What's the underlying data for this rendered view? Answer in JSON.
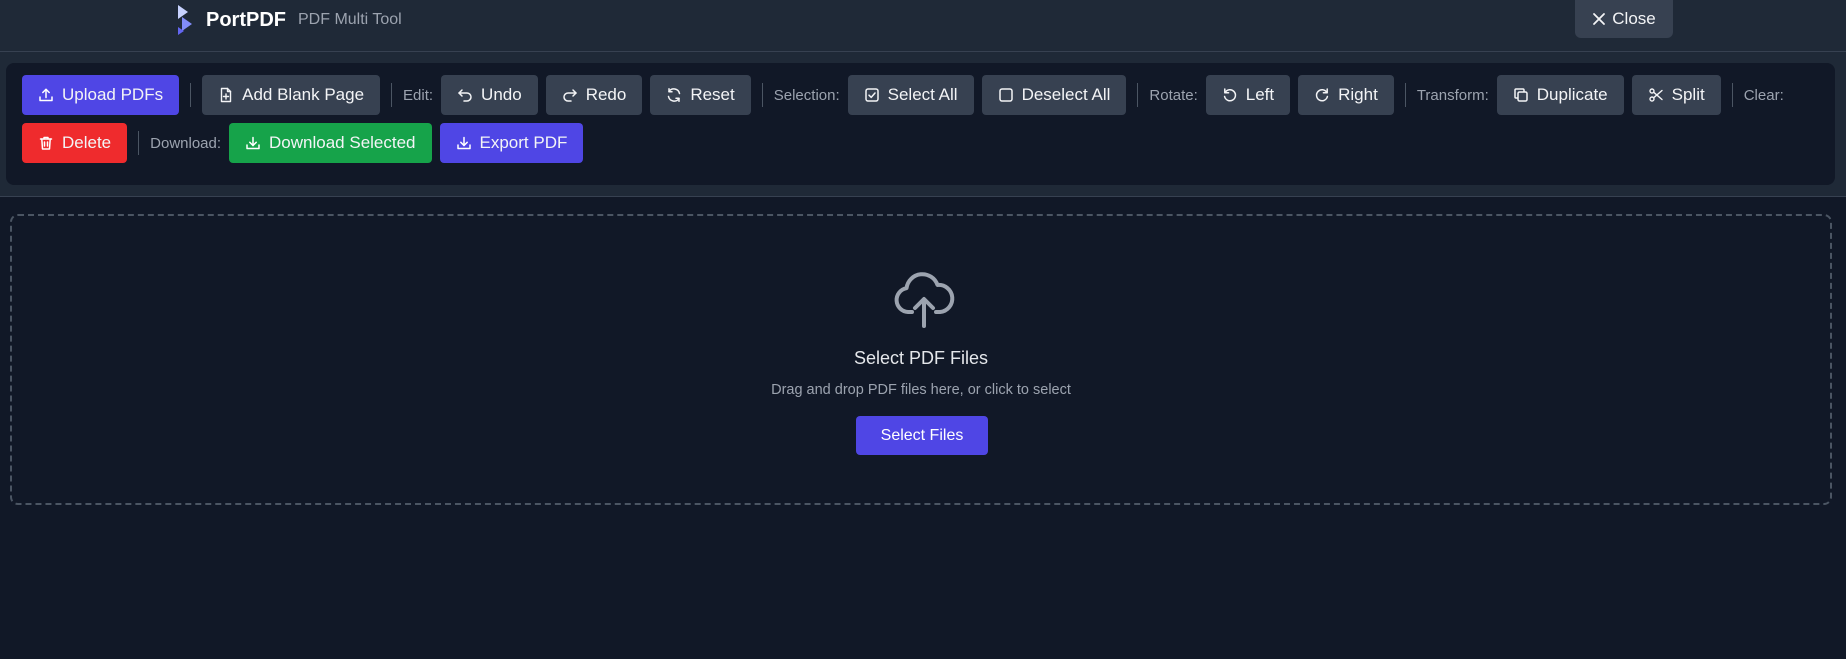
{
  "header": {
    "brand_name": "PortPDF",
    "brand_subtitle": "PDF Multi Tool",
    "close_label": "Close"
  },
  "toolbar": {
    "upload_label": "Upload PDFs",
    "add_blank_label": "Add Blank Page",
    "edit_label": "Edit:",
    "undo_label": "Undo",
    "redo_label": "Redo",
    "reset_label": "Reset",
    "selection_label": "Selection:",
    "select_all_label": "Select All",
    "deselect_all_label": "Deselect All",
    "rotate_label": "Rotate:",
    "rotate_left_label": "Left",
    "rotate_right_label": "Right",
    "transform_label": "Transform:",
    "duplicate_label": "Duplicate",
    "split_label": "Split",
    "clear_label": "Clear:",
    "delete_label": "Delete",
    "download_label": "Download:",
    "download_selected_label": "Download Selected",
    "export_label": "Export PDF"
  },
  "dropzone": {
    "title": "Select PDF Files",
    "subtitle": "Drag and drop PDF files here, or click to select",
    "button_label": "Select Files"
  },
  "icons": {
    "logo": "portpdf-logo-icon",
    "close": "close-icon",
    "upload": "upload-icon",
    "add_page": "file-plus-icon",
    "undo": "undo-icon",
    "redo": "redo-icon",
    "reset": "refresh-icon",
    "select_all": "checkbox-checked-icon",
    "deselect_all": "checkbox-empty-icon",
    "rotate_left": "rotate-left-icon",
    "rotate_right": "rotate-right-icon",
    "duplicate": "copy-icon",
    "split": "scissors-icon",
    "delete": "trash-icon",
    "download": "download-icon",
    "cloud_upload": "cloud-upload-icon"
  },
  "colors": {
    "background": "#111827",
    "panel": "#1f2937",
    "button": "#374151",
    "primary": "#4f46e5",
    "danger": "#ef2b2d",
    "success": "#16a34a"
  }
}
